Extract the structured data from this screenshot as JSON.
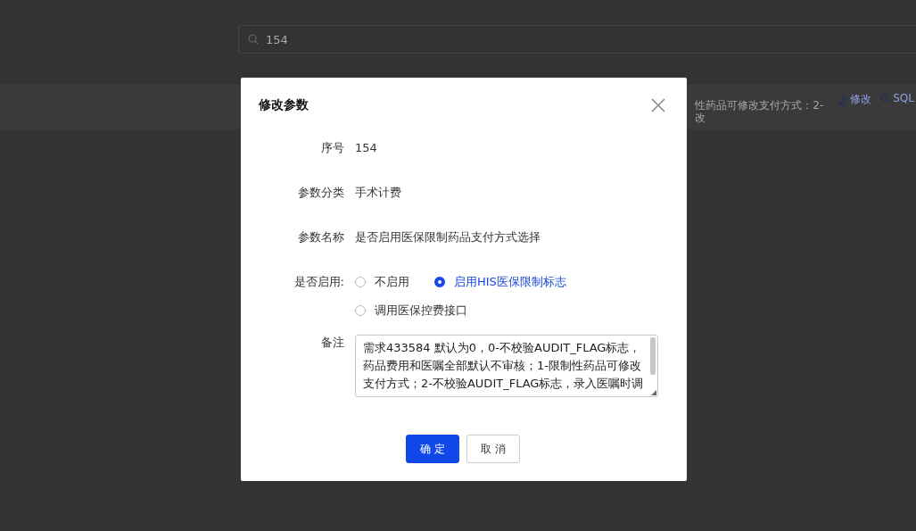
{
  "search": {
    "value": "154"
  },
  "background_row": {
    "text_lines": [
      "性药品可修改支付方式：2-",
      "改"
    ],
    "actions": [
      {
        "label": "修改",
        "kind": "edit"
      },
      {
        "label": "SQL",
        "kind": "search"
      }
    ]
  },
  "dialog": {
    "title": "修改参数",
    "fields": [
      {
        "kind": "text",
        "label": "序号",
        "value": "154"
      },
      {
        "kind": "text",
        "label": "参数分类",
        "value": "手术计费"
      },
      {
        "kind": "text",
        "label": "参数名称",
        "value": "是否启用医保限制药品支付方式选择"
      },
      {
        "kind": "radio",
        "label": "是否启用:",
        "options": [
          {
            "label": "不启用",
            "selected": false
          },
          {
            "label": "启用HIS医保限制标志",
            "selected": true
          },
          {
            "label": "调用医保控费接口",
            "selected": false
          }
        ]
      },
      {
        "kind": "textarea",
        "label": "备注",
        "value": "需求433584 默认为0，0-不校验AUDIT_FLAG标志，药品费用和医嘱全部默认不审核；1-限制性药品可修改支付方式；2-不校验AUDIT_FLAG标志，录入医嘱时调"
      }
    ],
    "buttons": [
      {
        "label": "确 定",
        "kind": "primary"
      },
      {
        "label": "取 消",
        "kind": "default"
      }
    ]
  }
}
